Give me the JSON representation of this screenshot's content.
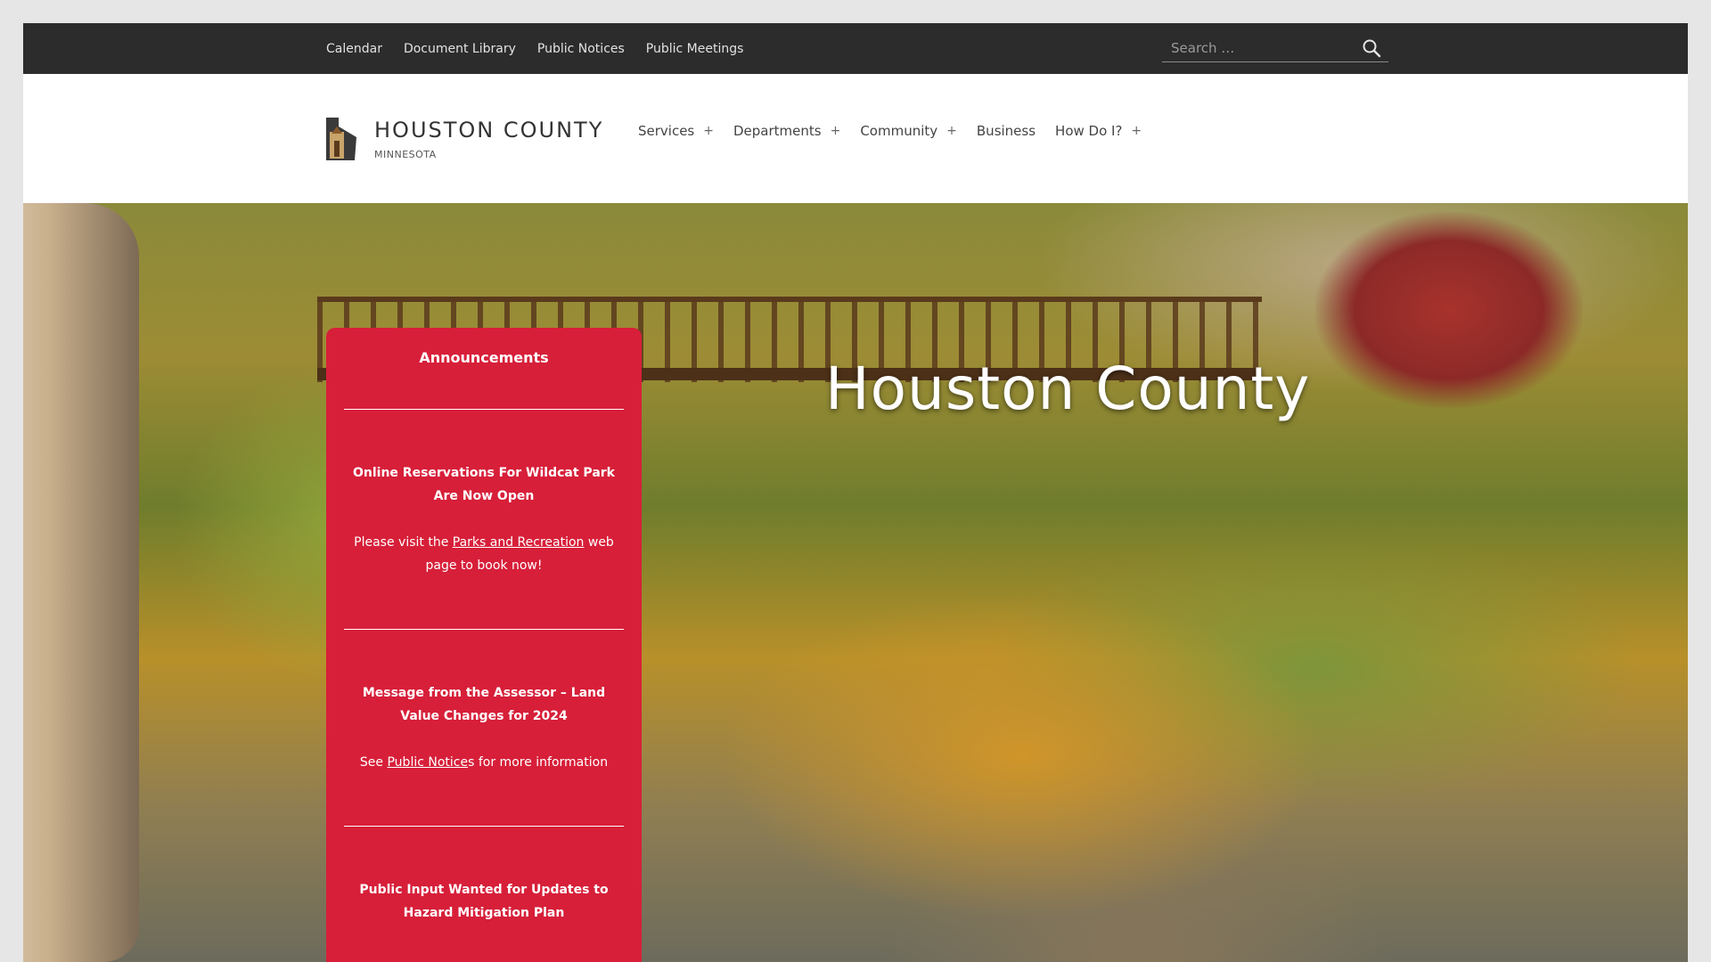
{
  "topnav": {
    "items": [
      "Calendar",
      "Document Library",
      "Public Notices",
      "Public Meetings"
    ]
  },
  "search": {
    "placeholder": "Search …"
  },
  "site": {
    "title": "HOUSTON COUNTY",
    "subtitle": "MINNESOTA"
  },
  "mainnav": {
    "items": [
      {
        "label": "Services",
        "expand": "+"
      },
      {
        "label": "Departments",
        "expand": "+"
      },
      {
        "label": "Community",
        "expand": "+"
      },
      {
        "label": "Business",
        "expand": ""
      },
      {
        "label": "How Do I?",
        "expand": "+"
      }
    ]
  },
  "hero": {
    "title": "Houston County"
  },
  "announcements": {
    "heading": "Announcements",
    "items": [
      {
        "title": "Online Reservations For Wildcat Park Are Now Open",
        "pre": "Please visit the ",
        "link": "Parks and Recreation",
        "post": " web page to book now!"
      },
      {
        "title": "Message from the Assessor – Land Value Changes for 2024",
        "pre": "See ",
        "link": "Public Notice",
        "post": "s for more information"
      },
      {
        "title": "Public Input Wanted for Updates to Hazard Mitigation Plan"
      }
    ]
  },
  "colors": {
    "topbar": "#2c2c2c",
    "accent": "#d71f39"
  }
}
